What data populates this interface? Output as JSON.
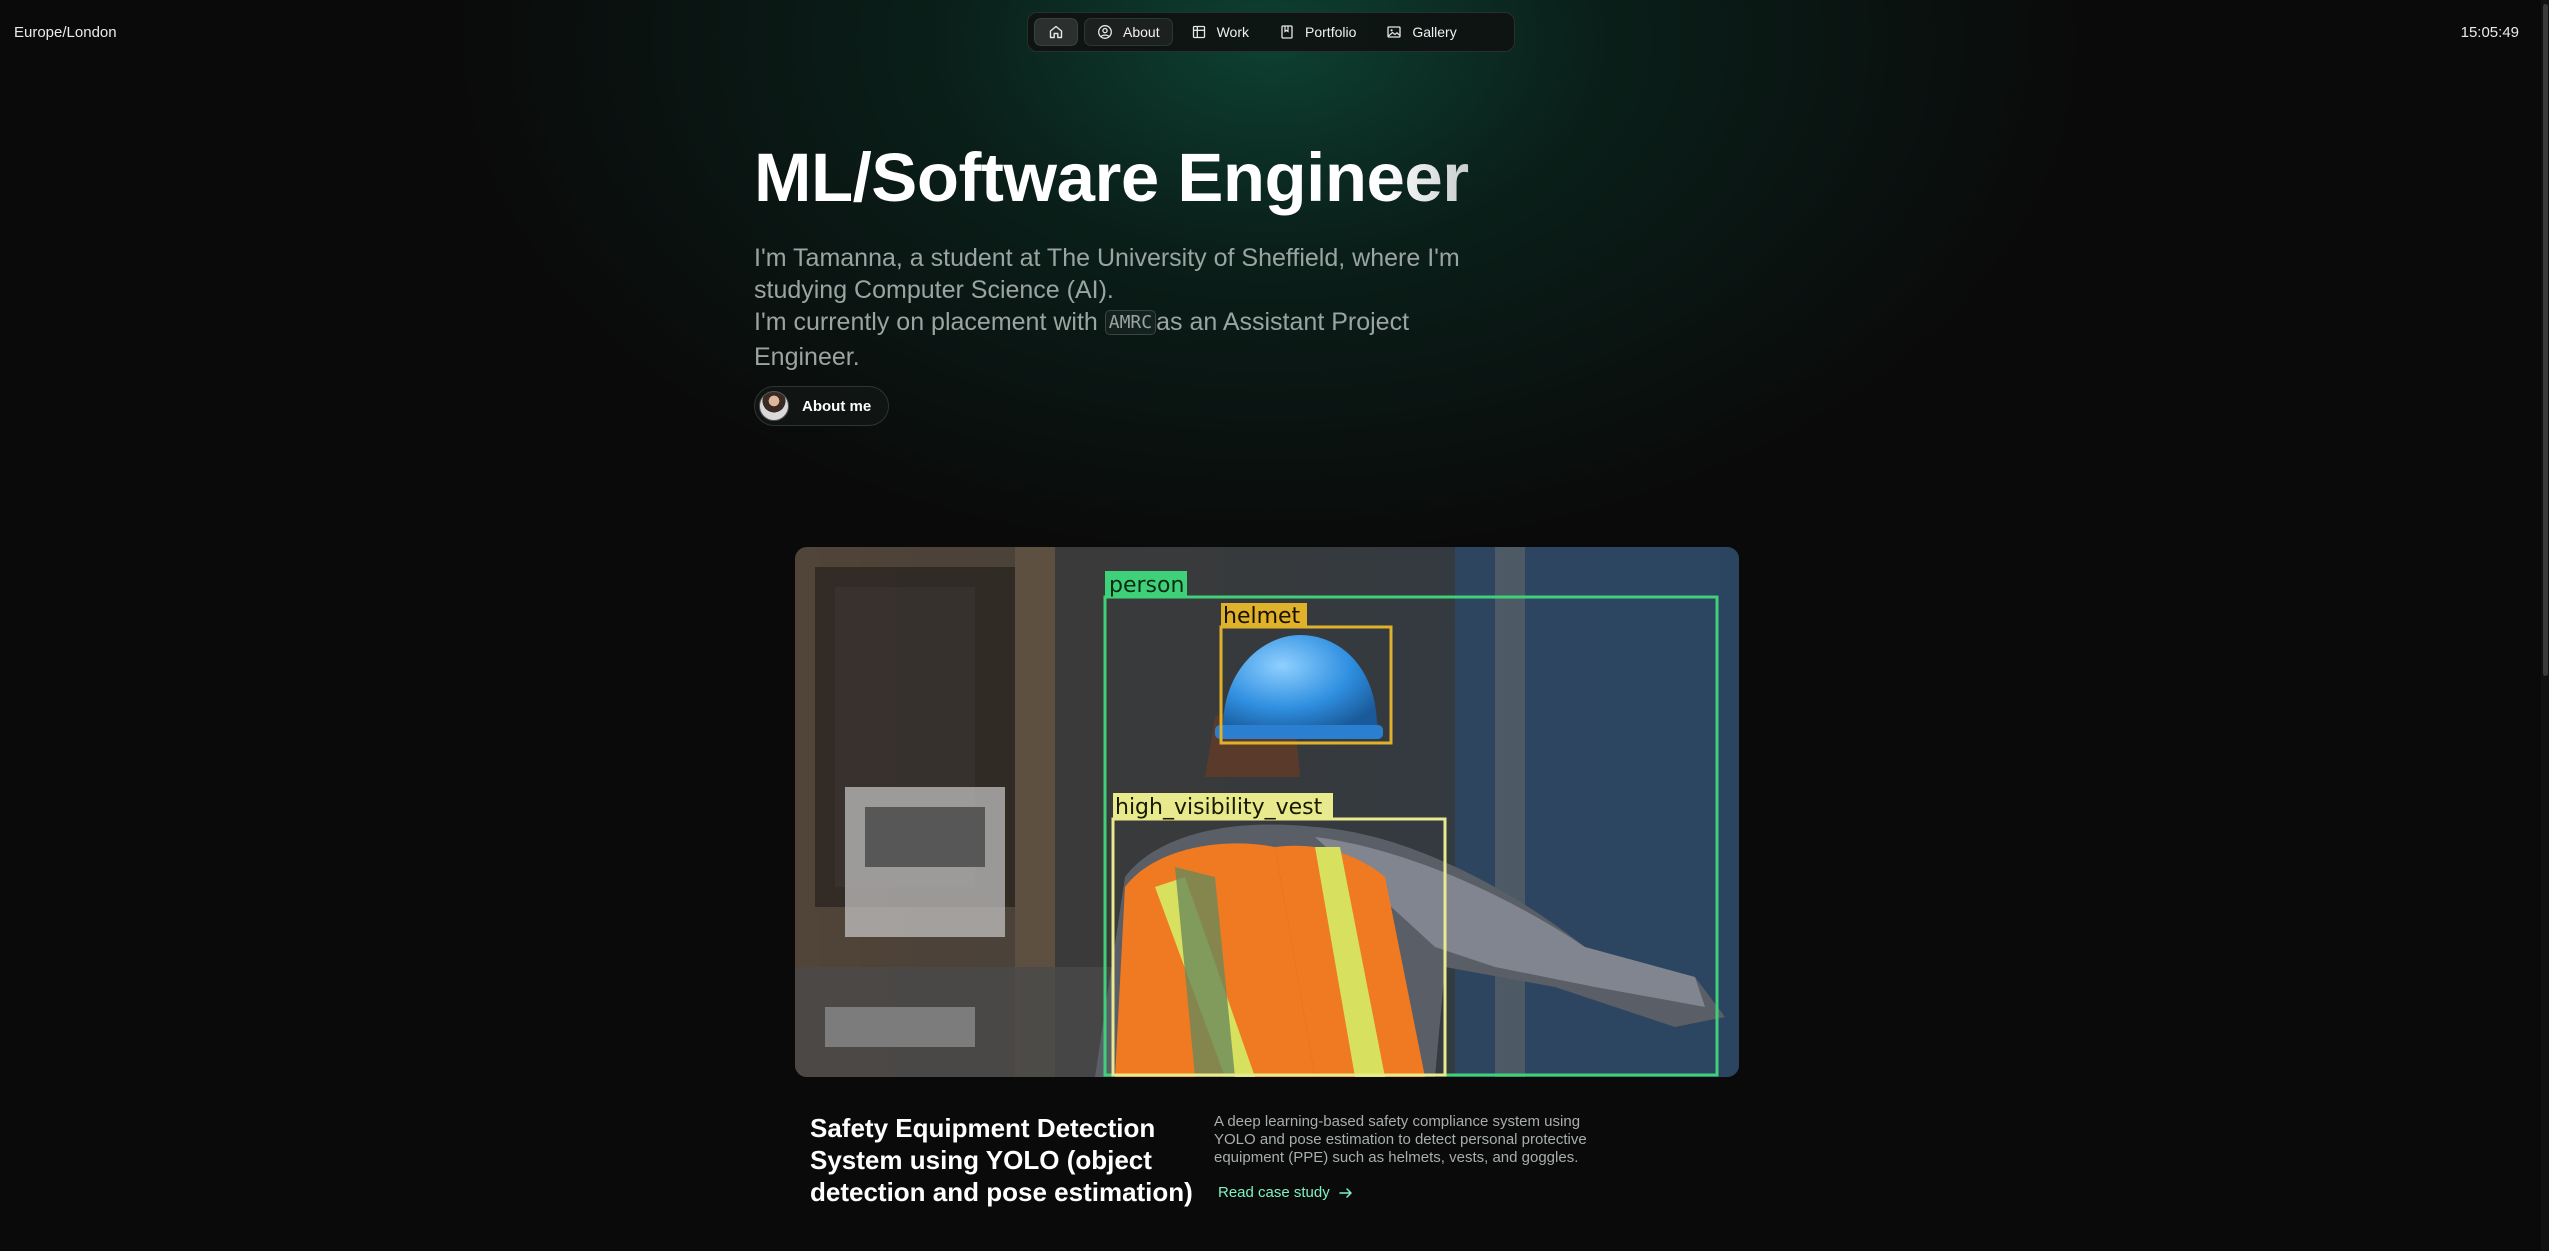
{
  "header": {
    "timezone": "Europe/London",
    "time": "15:05:49"
  },
  "nav": {
    "home_icon": "home-icon",
    "items": [
      {
        "label": "About",
        "icon": "person-circle-icon",
        "active": true
      },
      {
        "label": "Work",
        "icon": "grid-icon",
        "active": false
      },
      {
        "label": "Portfolio",
        "icon": "book-icon",
        "active": false
      },
      {
        "label": "Gallery",
        "icon": "image-icon",
        "active": false
      }
    ]
  },
  "hero": {
    "title": "ML/Software Engineer",
    "intro_line1": "I'm Tamanna, a student at The University of Sheffield, where I'm studying Computer Science (AI).",
    "intro_line2_before": "I'm currently on placement with ",
    "intro_badge": "AMRC",
    "intro_line2_after": "as an Assistant Project Engineer.",
    "about_button": "About me"
  },
  "project": {
    "image_labels": {
      "person": "person",
      "helmet": "helmet",
      "vest": "high_visibility_vest"
    },
    "title": "Safety Equipment Detection System using YOLO (object detection and pose estimation)",
    "description": "A deep learning-based safety compliance system using YOLO and pose estimation to detect personal protective equipment (PPE) such as helmets, vests, and goggles.",
    "link": "Read case study"
  },
  "colors": {
    "background": "#0a0a0a",
    "accent_green": "#7ef2c2",
    "box_person": "#3fd17a",
    "box_helmet": "#e0b12a",
    "box_vest": "#e9ea8e"
  }
}
